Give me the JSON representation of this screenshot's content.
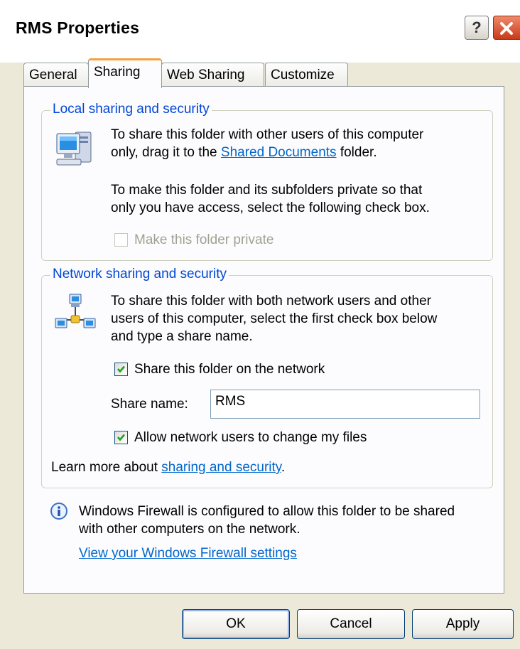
{
  "window": {
    "title": "RMS Properties",
    "help_glyph": "?"
  },
  "tabs": [
    {
      "label": "General",
      "active": false
    },
    {
      "label": "Sharing",
      "active": true
    },
    {
      "label": "Web Sharing",
      "active": false
    },
    {
      "label": "Customize",
      "active": false
    }
  ],
  "local": {
    "legend": "Local sharing and security",
    "line1": "To share this folder with other users of this computer",
    "line2_pre": "only, drag it to the ",
    "line2_link": "Shared Documents",
    "line2_post": " folder.",
    "line3": "To make this folder and its subfolders private so that",
    "line4": "only you have access, select the following check box.",
    "private_checkbox_label": "Make this folder private",
    "private_checked": false,
    "private_enabled": false,
    "icon": "computer-icon"
  },
  "network": {
    "legend": "Network sharing and security",
    "line1": "To share this folder with both network users and other",
    "line2": "users of this computer, select the first check box below",
    "line3": "and type a share name.",
    "share_checkbox_label": "Share this folder on the network",
    "share_checked": true,
    "share_name_label": "Share name:",
    "share_name_value": "RMS",
    "allow_change_label": "Allow network users to change my files",
    "allow_change_checked": true,
    "learn_pre": "Learn more about ",
    "learn_link": "sharing and security",
    "learn_post": ".",
    "icon": "network-icon"
  },
  "firewall": {
    "line1": "Windows Firewall is configured to allow this folder to be shared",
    "line2": "with other computers on the network.",
    "link": "View your Windows Firewall settings",
    "icon": "info-icon"
  },
  "buttons": {
    "ok": "OK",
    "cancel": "Cancel",
    "apply": "Apply"
  },
  "colors": {
    "dialog_bg": "#ece9d8",
    "link": "#0066cc",
    "legend": "#0046d5",
    "active_tab_accent": "#f7a13a"
  }
}
